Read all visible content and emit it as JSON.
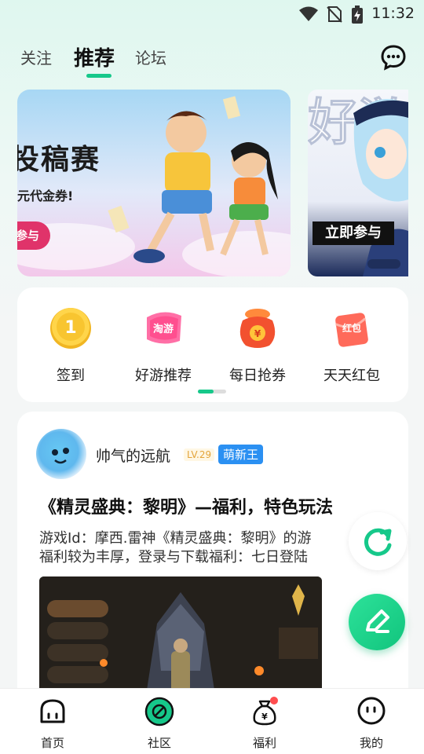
{
  "status_bar": {
    "time": "11:32"
  },
  "top_tabs": [
    {
      "label": "关注",
      "active": false
    },
    {
      "label": "推荐",
      "active": true
    },
    {
      "label": "论坛",
      "active": false
    }
  ],
  "header": {
    "message_icon": "chat-bubble-icon"
  },
  "banners": {
    "main": {
      "title": "投稿赛",
      "subtitle": "元代金券!",
      "button": "参与"
    },
    "side": {
      "watermark": "好游",
      "button": "立即参与"
    }
  },
  "quick_actions": [
    {
      "label": "签到",
      "icon": "gold-coin-icon"
    },
    {
      "label": "好游推荐",
      "icon": "haoyou-badge-icon"
    },
    {
      "label": "每日抢券",
      "icon": "lucky-bag-icon"
    },
    {
      "label": "天天红包",
      "icon": "red-packet-icon"
    }
  ],
  "post": {
    "author": "帅气的远航",
    "level": "LV.29",
    "badge": "萌新王",
    "title": "《精灵盛典：黎明》—福利，特色玩法",
    "body": "游戏Id：摩西.雷神《精灵盛典：黎明》的游\n福利较为丰厚，登录与下载福利：七日登陆"
  },
  "colors": {
    "accent": "#16c88a",
    "badge_blue": "#2b90f2",
    "banner_pink": "#e0336a"
  },
  "bottom_nav": [
    {
      "label": "首页",
      "icon": "home-icon"
    },
    {
      "label": "社区",
      "icon": "community-icon"
    },
    {
      "label": "福利",
      "icon": "welfare-bag-icon"
    },
    {
      "label": "我的",
      "icon": "profile-face-icon"
    }
  ]
}
